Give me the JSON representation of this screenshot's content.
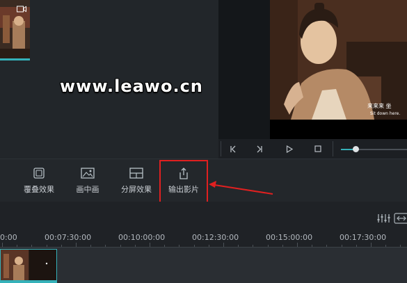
{
  "watermark": "www.leawo.cn",
  "preview": {
    "subtitle_cn": "来来来 坐",
    "subtitle_en": "Sit down here."
  },
  "player": {
    "controls": [
      {
        "icon": "step-back-icon",
        "glyph": "|<"
      },
      {
        "icon": "step-forward-icon",
        "glyph": ">|"
      },
      {
        "icon": "play-icon",
        "glyph": "▷"
      },
      {
        "icon": "stop-icon",
        "glyph": "□"
      }
    ],
    "volume": 0.25
  },
  "toolbar": {
    "items": [
      {
        "label": "覆叠效果",
        "icon": "overlay-icon"
      },
      {
        "label": "画中画",
        "icon": "picture-in-picture-icon"
      },
      {
        "label": "分屏效果",
        "icon": "split-screen-icon"
      },
      {
        "label": "输出影片",
        "icon": "export-icon"
      }
    ]
  },
  "timeline": {
    "timecodes": [
      "0:00",
      "00:07:30:00",
      "00:10:00:00",
      "00:12:30:00",
      "00:15:00:00",
      "00:17:30:00"
    ]
  },
  "colors": {
    "accent": "#35b1b9",
    "highlight": "#e02020"
  }
}
